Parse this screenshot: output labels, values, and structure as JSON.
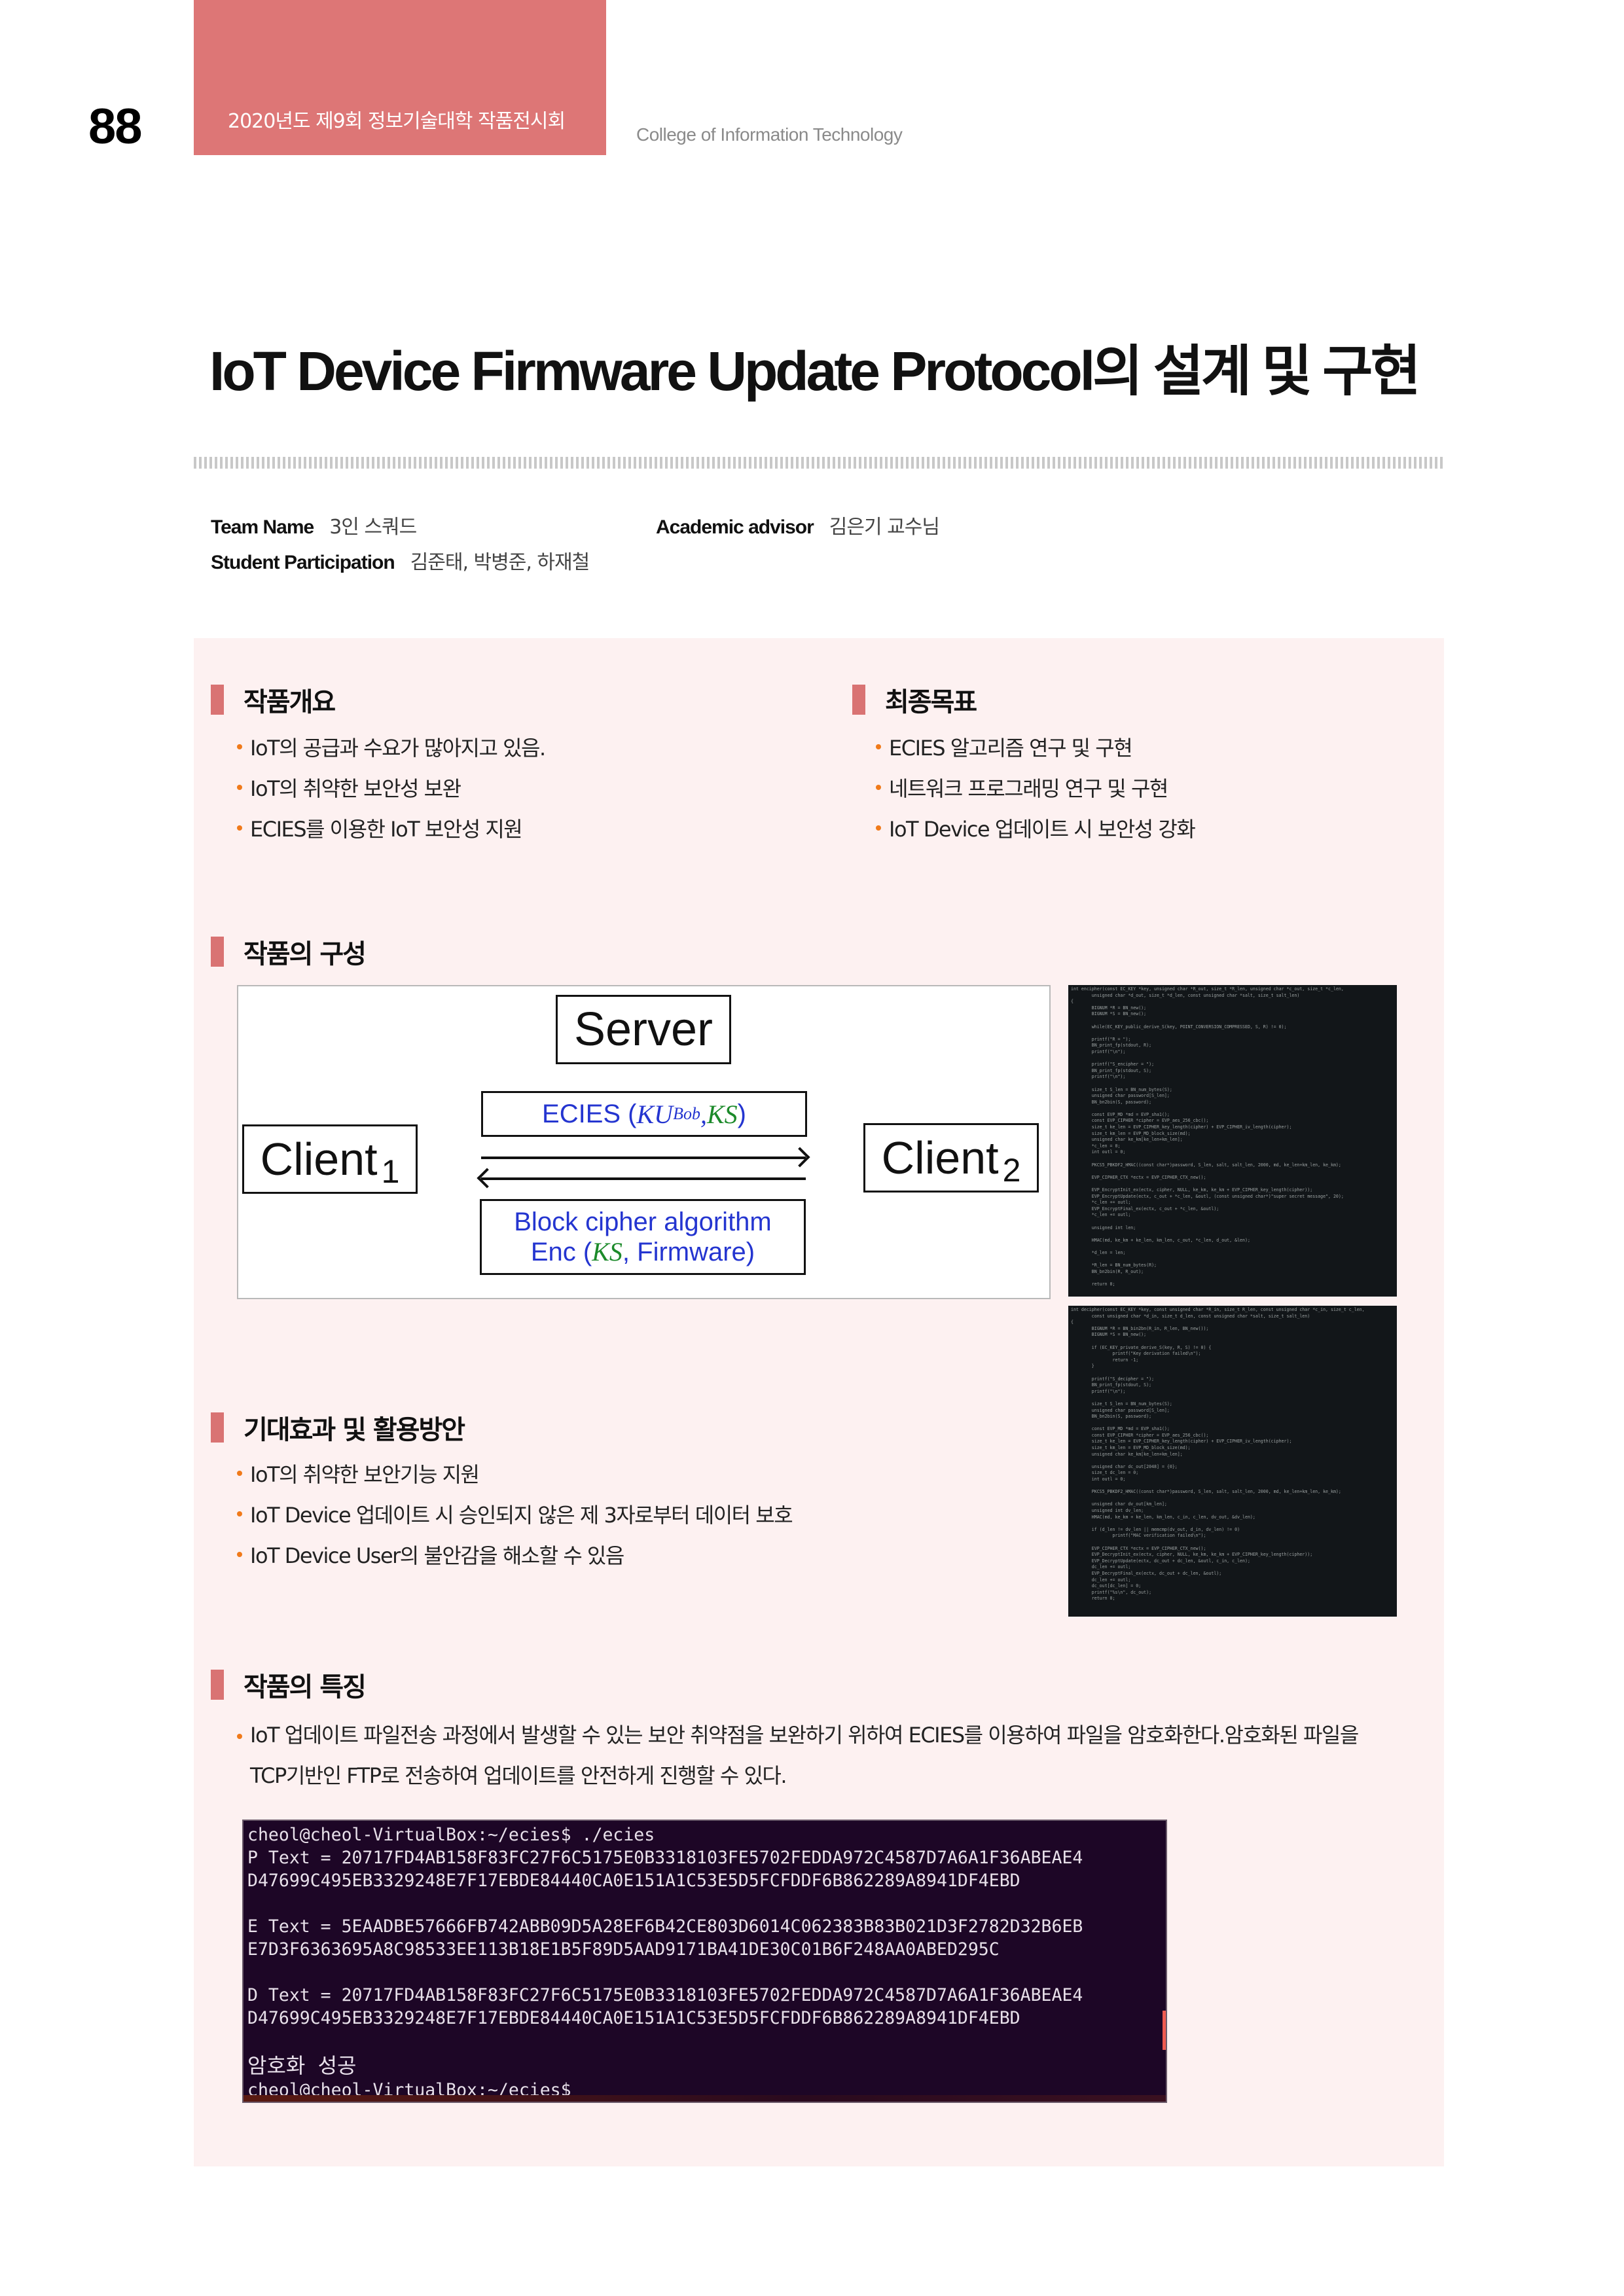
{
  "header": {
    "page_number": "88",
    "event_title": "2020년도 제9회 정보기술대학 작품전시회",
    "college": "College of Information Technology",
    "accent_color": "#dd7676"
  },
  "title": "IoT Device Firmware Update Protocol의 설계 및 구현",
  "team": {
    "team_name_label": "Team Name",
    "team_name": "3인 스쿼드",
    "advisor_label": "Academic advisor",
    "advisor": "김은기 교수님",
    "students_label": "Student Participation",
    "students": "김준태, 박병준, 하재철"
  },
  "sections": {
    "overview": {
      "title": "작품개요",
      "items": [
        "IoT의 공급과 수요가 많아지고 있음.",
        "IoT의 취약한 보안성 보완",
        "ECIES를 이용한 IoT 보안성 지원"
      ]
    },
    "goal": {
      "title": "최종목표",
      "items": [
        "ECIES 알고리즘 연구 및 구현",
        "네트워크 프로그래밍 연구 및 구현",
        "IoT Device 업데이트 시 보안성 강화"
      ]
    },
    "structure": {
      "title": "작품의 구성"
    },
    "effects": {
      "title": "기대효과 및 활용방안",
      "items": [
        "IoT의 취약한 보안기능 지원",
        "IoT Device 업데이트 시 승인되지 않은 제 3자로부터 데이터 보호",
        "IoT Device User의 불안감을 해소할 수 있음"
      ]
    },
    "features": {
      "title": "작품의 특징",
      "line1": "IoT 업데이트 파일전송 과정에서 발생할 수 있는 보안 취약점을 보완하기 위하여 ECIES를 이용하여 파일을 암호화한다.암호화된 파일을",
      "line2": "TCP기반인 FTP로 전송하여 업데이트를 안전하게 진행할 수 있다."
    }
  },
  "diagram": {
    "server": "Server",
    "client1": "Client",
    "client1_sub": "1",
    "client2": "Client",
    "client2_sub": "2",
    "ecies_prefix": "ECIES (",
    "ecies_ku": "KU",
    "ecies_ku_sub": "Bob",
    "ecies_comma": ", ",
    "ecies_ks": "KS",
    "ecies_suffix": ")",
    "block_line1": "Block cipher algorithm",
    "block_enc_prefix": "Enc (",
    "block_ks": "KS",
    "block_enc_suffix": ", Firmware)"
  },
  "code_encipher": "int encipher(const EC_KEY *key, unsigned char *R_out, size_t *R_len, unsigned char *c_out, size_t *c_len,\n        unsigned char *d_out, size_t *d_len, const unsigned char *salt, size_t salt_len)\n{\n        BIGNUM *R = BN_new();\n        BIGNUM *S = BN_new();\n\n        while(EC_KEY_public_derive_S(key, POINT_CONVERSION_COMPRESSED, S, R) != 0);\n\n        printf(\"R = \");\n        BN_print_fp(stdout, R);\n        printf(\"\\n\");\n\n        printf(\"S_encipher = \");\n        BN_print_fp(stdout, S);\n        printf(\"\\n\");\n\n        size_t S_len = BN_num_bytes(S);\n        unsigned char password[S_len];\n        BN_bn2bin(S, password);\n\n        const EVP_MD *md = EVP_sha1();\n        const EVP_CIPHER *cipher = EVP_aes_256_cbc();\n        size_t ke_len = EVP_CIPHER_key_length(cipher) + EVP_CIPHER_iv_length(cipher);\n        size_t km_len = EVP_MD_block_size(md);\n        unsigned char ke_km[ke_len+km_len];\n        *c_len = 0;\n        int outl = 0;\n\n        PKCS5_PBKDF2_HMAC((const char*)password, S_len, salt, salt_len, 2000, md, ke_len+km_len, ke_km);\n\n        EVP_CIPHER_CTX *ectx = EVP_CIPHER_CTX_new();\n\n        EVP_EncryptInit_ex(ectx, cipher, NULL, ke_km, ke_km + EVP_CIPHER_key_length(cipher));\n        EVP_EncryptUpdate(ectx, c_out + *c_len, &outl, (const unsigned char*)\"super secret message\", 20);\n        *c_len += outl;\n        EVP_EncryptFinal_ex(ectx, c_out + *c_len, &outl);\n        *c_len += outl;\n\n        unsigned int len;\n\n        HMAC(md, ke_km + ke_len, km_len, c_out, *c_len, d_out, &len);\n\n        *d_len = len;\n\n        *R_len = BN_num_bytes(R);\n        BN_bn2bin(R, R_out);\n\n        return 0;",
  "code_decipher": "int decipher(const EC_KEY *key, const unsigned char *R_in, size_t R_len, const unsigned char *c_in, size_t c_len,\n        const unsigned char *d_in, size_t d_len, const unsigned char *salt, size_t salt_len)\n{\n        BIGNUM *R = BN_bin2bn(R_in, R_len, BN_new());\n        BIGNUM *S = BN_new();\n\n        if (EC_KEY_private_derive_S(key, R, S) != 0) {\n                printf(\"Key derivation failed\\n\");\n                return -1;\n        }\n\n        printf(\"S_decipher = \");\n        BN_print_fp(stdout, S);\n        printf(\"\\n\");\n\n        size_t S_len = BN_num_bytes(S);\n        unsigned char password[S_len];\n        BN_bn2bin(S, password);\n\n        const EVP_MD *md = EVP_sha1();\n        const EVP_CIPHER *cipher = EVP_aes_256_cbc();\n        size_t ke_len = EVP_CIPHER_key_length(cipher) + EVP_CIPHER_iv_length(cipher);\n        size_t km_len = EVP_MD_block_size(md);\n        unsigned char ke_km[ke_len+km_len];\n\n        unsigned char dc_out[2048] = {0};\n        size_t dc_len = 0;\n        int outl = 0;\n\n        PKCS5_PBKDF2_HMAC((const char*)password, S_len, salt, salt_len, 2000, md, ke_len+km_len, ke_km);\n\n        unsigned char dv_out[km_len];\n        unsigned int dv_len;\n        HMAC(md, ke_km + ke_len, km_len, c_in, c_len, dv_out, &dv_len);\n\n        if (d_len != dv_len || memcmp(dv_out, d_in, dv_len) != 0)\n                printf(\"MAC verification failed\\n\");\n\n        EVP_CIPHER_CTX *ectx = EVP_CIPHER_CTX_new();\n        EVP_DecryptInit_ex(ectx, cipher, NULL, ke_km, ke_km + EVP_CIPHER_key_length(cipher));\n        EVP_DecryptUpdate(ectx, dc_out + dc_len, &outl, c_in, c_len);\n        dc_len += outl;\n        EVP_DecryptFinal_ex(ectx, dc_out + dc_len, &outl);\n        dc_len += outl;\n        dc_out[dc_len] = 0;\n        printf(\"%s\\n\", dc_out);\n        return 0;",
  "terminal": {
    "line_cmd": "cheol@cheol-VirtualBox:~/ecies$ ./ecies",
    "p_text_1": "P Text = 20717FD4AB158F83FC27F6C5175E0B3318103FE5702FEDDA972C4587D7A6A1F36ABEAE4",
    "p_text_2": "D47699C495EB3329248E7F17EBDE84440CA0E151A1C53E5D5FCFDDF6B862289A8941DF4EBD",
    "e_text_1": "E Text = 5EAADBE57666FB742ABB09D5A28EF6B42CE803D6014C062383B83B021D3F2782D32B6EB",
    "e_text_2": "E7D3F6363695A8C98533EE113B18E1B5F89D5AAD9171BA41DE30C01B6F248AA0ABED295C",
    "d_text_1": "D Text = 20717FD4AB158F83FC27F6C5175E0B3318103FE5702FEDDA972C4587D7A6A1F36ABEAE4",
    "d_text_2": "D47699C495EB3329248E7F17EBDE84440CA0E151A1C53E5D5FCFDDF6B862289A8941DF4EBD",
    "success": "암호화 성공",
    "prompt": "cheol@cheol-VirtualBox:~/ecies$"
  }
}
